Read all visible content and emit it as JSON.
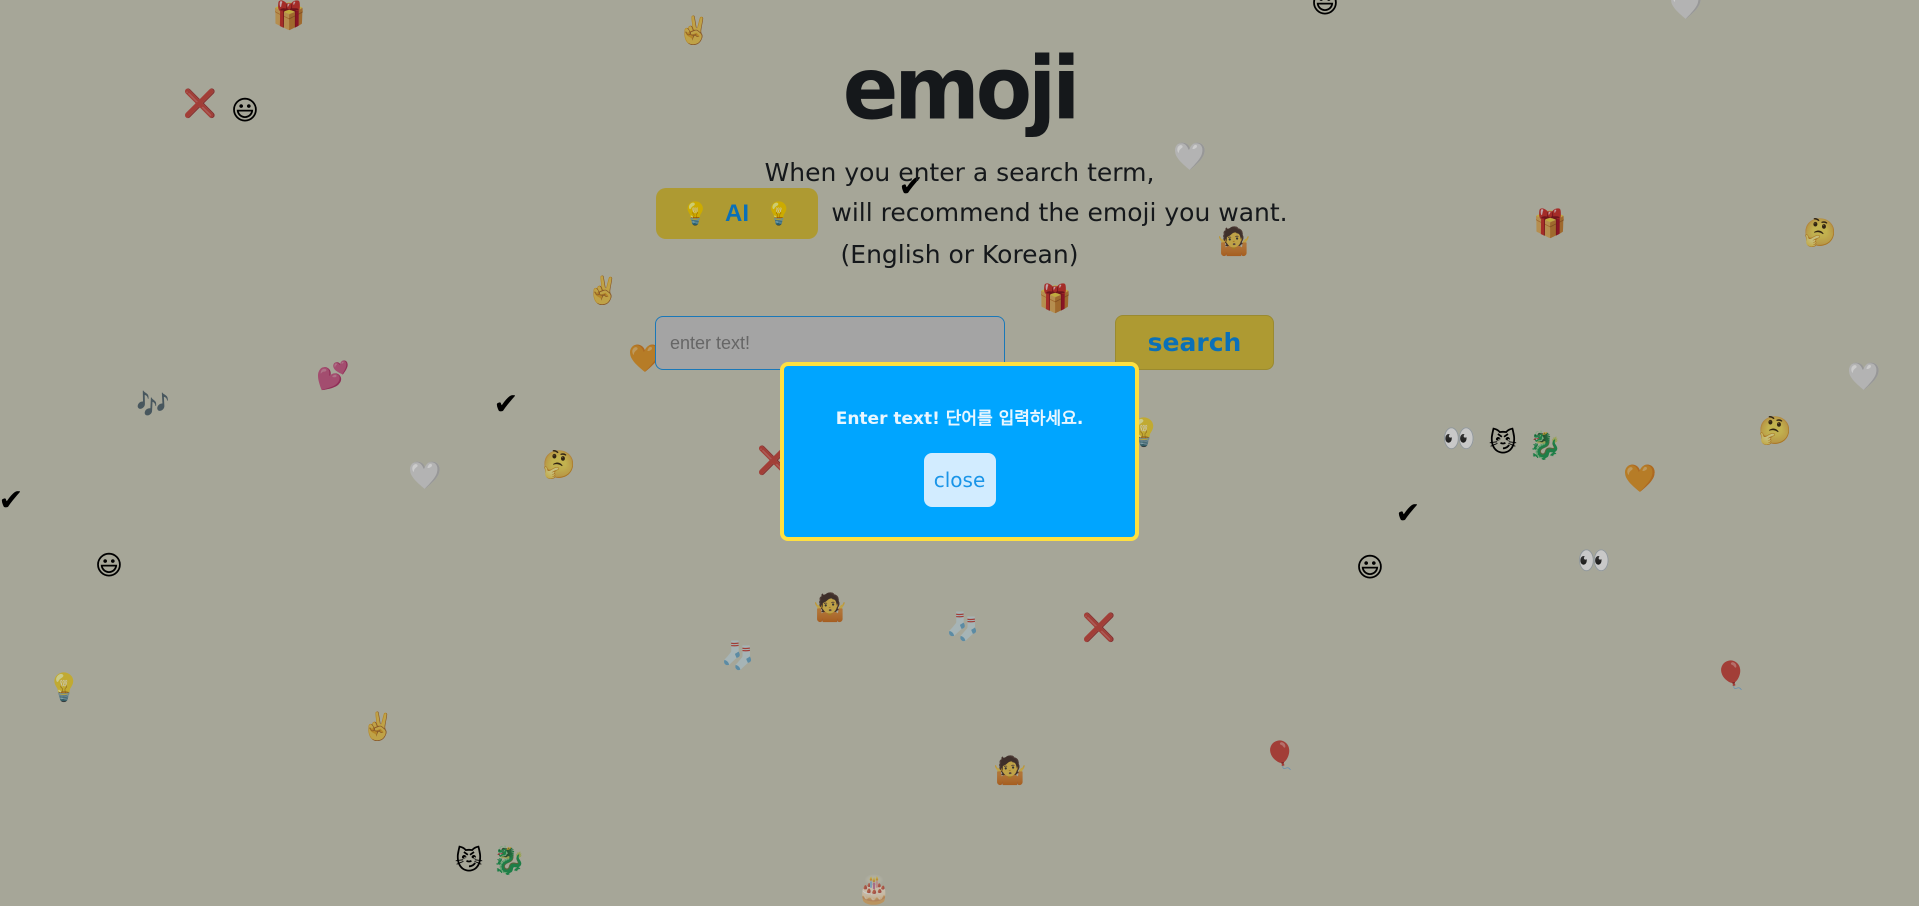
{
  "header": {
    "title": "emoji"
  },
  "description": {
    "line1": "When you enter a search term,",
    "line2": "will recommend the emoji you want.",
    "line3": "(English or Korean)"
  },
  "ai_badge": {
    "label": "AI",
    "icon": "💡"
  },
  "search": {
    "placeholder": "enter text!",
    "value": "",
    "button_label": "search"
  },
  "modal": {
    "message": "Enter text! 단어를 입력하세요.",
    "close_label": "close"
  },
  "background_emojis": [
    "🎁",
    "✌️",
    "😃",
    "🤍",
    "❌",
    "😃",
    "🤍",
    "✔",
    "🎁",
    "🤔",
    "🤷",
    "✌️",
    "🎁",
    "🧡",
    "💕",
    "🤍",
    "🎶",
    "✔",
    "💡",
    "👀",
    "😼",
    "🐉",
    "🤔",
    "🤍",
    "🤔",
    "❌",
    "🧡",
    "✔",
    "✔",
    "😃",
    "😃",
    "👀",
    "🤷",
    "🧦",
    "❌",
    "🧦",
    "💡",
    "🎈",
    "✌️",
    "🎈",
    "🤷",
    "😼",
    "🐉",
    "🎂"
  ],
  "colors": {
    "modal_bg": "#00a5ff",
    "modal_border": "#ffe040",
    "accent": "#ae9a32",
    "text_accent": "#0a70b8"
  }
}
